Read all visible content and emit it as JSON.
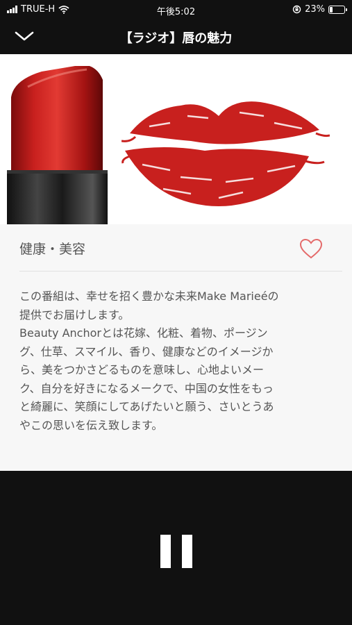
{
  "status_bar": {
    "carrier": "TRUE-H",
    "time": "午後5:02",
    "battery": "23%",
    "battery_level": 0.23
  },
  "header": {
    "title": "【ラジオ】唇の魅力"
  },
  "program": {
    "category": "健康・美容",
    "description": "この番組は、幸せを招く豊かな未来Make Marieéの\n提供でお届けします。\nBeauty Anchorとは花嫁、化粧、着物、ポージン\nグ、仕草、スマイル、香り、健康などのイメージか\nら、美をつかさどるものを意味し、心地よいメー\nク、自分を好きになるメークで、中国の女性をもっ\nと綺麗に、笑顔にしてあげたいと願う、さいとうあ\nやこの思いを伝え致します。"
  },
  "colors": {
    "lipstick_red": "#c8201e",
    "lips_red": "#c8201e",
    "heart": "#e46a6a"
  },
  "icons": {
    "back": "chevron-down-icon",
    "favorite": "heart-outline-icon",
    "player": "pause-icon"
  }
}
